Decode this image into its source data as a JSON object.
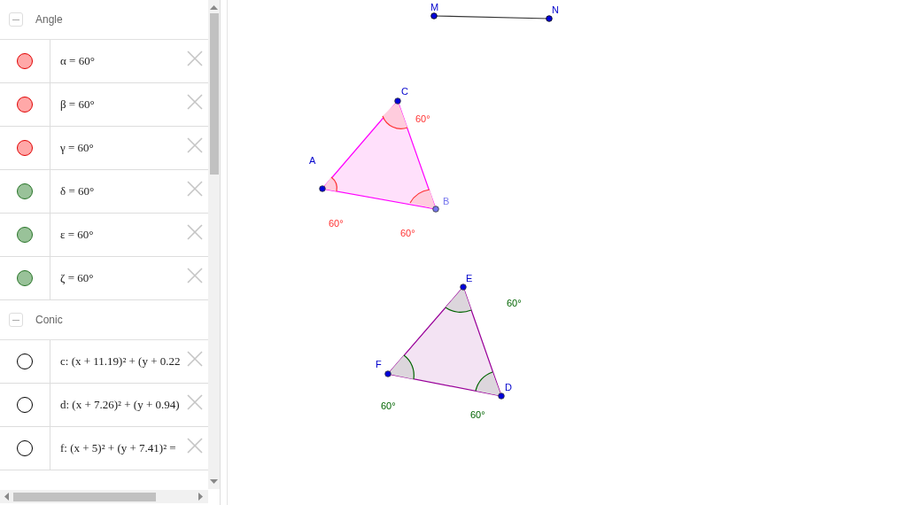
{
  "algebra_view": {
    "groups": [
      {
        "title": "Angle",
        "expanded": true,
        "items": [
          {
            "text": "α = 60°",
            "visible": true,
            "color": "#ffa8a8"
          },
          {
            "text": "β = 60°",
            "visible": true,
            "color": "#ffa8a8"
          },
          {
            "text": "γ = 60°",
            "visible": true,
            "color": "#ffa8a8"
          },
          {
            "text": "δ = 60°",
            "visible": true,
            "color": "#99c299"
          },
          {
            "text": "ε = 60°",
            "visible": true,
            "color": "#99c299"
          },
          {
            "text": "ζ = 60°",
            "visible": true,
            "color": "#99c299"
          }
        ]
      },
      {
        "title": "Conic",
        "expanded": true,
        "items": [
          {
            "text": "c: (x + 11.19)² + (y + 0.22",
            "visible": false
          },
          {
            "text": "d: (x + 7.26)² + (y + 0.94)",
            "visible": false
          },
          {
            "text": "f: (x + 5)² + (y + 7.41)² =",
            "visible": false
          }
        ]
      }
    ]
  },
  "graphics_view": {
    "segment": {
      "points": [
        "M",
        "N"
      ]
    },
    "triangles": [
      {
        "points": [
          "A",
          "C",
          "B"
        ],
        "angle_labels": [
          "60°",
          "60°",
          "60°"
        ]
      },
      {
        "points": [
          "E",
          "F",
          "D"
        ],
        "angle_labels": [
          "60°",
          "60°",
          "60°"
        ]
      }
    ]
  }
}
